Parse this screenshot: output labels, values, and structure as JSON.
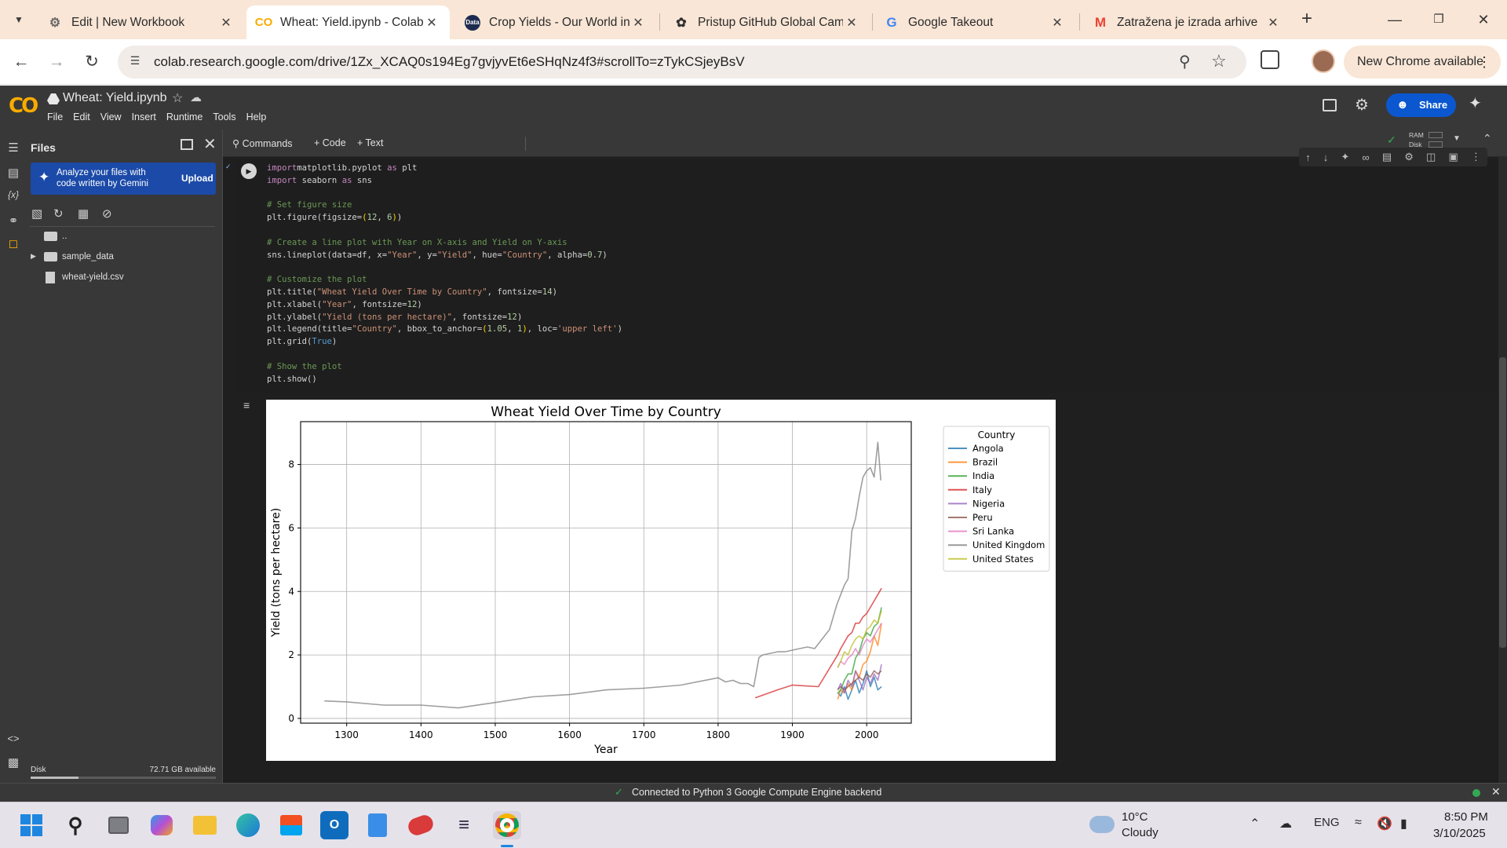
{
  "browser": {
    "tabs": [
      {
        "label": "Edit | New Workbook",
        "icon": "gear-icon",
        "active": false
      },
      {
        "label": "Wheat: Yield.ipynb - Colab",
        "icon": "colab-icon",
        "active": true
      },
      {
        "label": "Crop Yields - Our World in",
        "icon": "data-icon",
        "active": false
      },
      {
        "label": "Pristup GitHub Global Cam",
        "icon": "openai-icon",
        "active": false
      },
      {
        "label": "Google Takeout",
        "icon": "google-icon",
        "active": false
      },
      {
        "label": "Zatražena je izrada arhive",
        "icon": "gmail-icon",
        "active": false
      }
    ],
    "url": "colab.research.google.com/drive/1Zx_XCAQ0s194Eg7gvjyvEt6eSHqNz4f3#scrollTo=zTykCSjeyBsV",
    "new_chrome_label": "New Chrome available"
  },
  "colab": {
    "title": "Wheat: Yield.ipynb",
    "menu": [
      "File",
      "Edit",
      "View",
      "Insert",
      "Runtime",
      "Tools",
      "Help"
    ],
    "share_label": "Share",
    "toolbar": {
      "commands": "Commands",
      "code": "+ Code",
      "text": "+ Text"
    },
    "ram_label": "RAM",
    "disk_label": "Disk"
  },
  "files_panel": {
    "title": "Files",
    "banner_text": "Analyze your files with code written by Gemini",
    "upload_label": "Upload",
    "tree": [
      {
        "name": "..",
        "type": "folder",
        "expandable": false
      },
      {
        "name": "sample_data",
        "type": "folder",
        "expandable": true
      },
      {
        "name": "wheat-yield.csv",
        "type": "file",
        "expandable": false
      }
    ],
    "disk_label": "Disk",
    "disk_available": "72.71 GB available",
    "disk_used_fraction": 0.26
  },
  "code_lines": [
    [
      [
        "kw",
        "import"
      ],
      [
        "",
        "matplotlib.pyplot "
      ],
      [
        "kw",
        "as"
      ],
      [
        "",
        " plt"
      ]
    ],
    [
      [
        "kw",
        "import"
      ],
      [
        "",
        " seaborn "
      ],
      [
        "kw",
        "as"
      ],
      [
        "",
        " sns"
      ]
    ],
    [],
    [
      [
        "cm",
        "# Set figure size"
      ]
    ],
    [
      [
        "",
        "plt.figure(figsize="
      ],
      [
        "br",
        "("
      ],
      [
        "nm",
        "12"
      ],
      [
        "",
        ", "
      ],
      [
        "nm",
        "6"
      ],
      [
        "br",
        ")"
      ],
      [
        "",
        ")"
      ]
    ],
    [],
    [
      [
        "cm",
        "# Create a line plot with Year on X-axis and Yield on Y-axis"
      ]
    ],
    [
      [
        "",
        "sns.lineplot(data=df, x="
      ],
      [
        "st",
        "\"Year\""
      ],
      [
        "",
        ", y="
      ],
      [
        "st",
        "\"Yield\""
      ],
      [
        "",
        ", hue="
      ],
      [
        "st",
        "\"Country\""
      ],
      [
        "",
        ", alpha="
      ],
      [
        "nm",
        "0.7"
      ],
      [
        "",
        ")"
      ]
    ],
    [],
    [
      [
        "cm",
        "# Customize the plot"
      ]
    ],
    [
      [
        "",
        "plt.title("
      ],
      [
        "st",
        "\"Wheat Yield Over Time by Country\""
      ],
      [
        "",
        ", fontsize="
      ],
      [
        "nm",
        "14"
      ],
      [
        "",
        ")"
      ]
    ],
    [
      [
        "",
        "plt.xlabel("
      ],
      [
        "st",
        "\"Year\""
      ],
      [
        "",
        ", fontsize="
      ],
      [
        "nm",
        "12"
      ],
      [
        "",
        ")"
      ]
    ],
    [
      [
        "",
        "plt.ylabel("
      ],
      [
        "st",
        "\"Yield (tons per hectare)\""
      ],
      [
        "",
        ", fontsize="
      ],
      [
        "nm",
        "12"
      ],
      [
        "",
        ")"
      ]
    ],
    [
      [
        "",
        "plt.legend(title="
      ],
      [
        "st",
        "\"Country\""
      ],
      [
        "",
        ", bbox_to_anchor="
      ],
      [
        "br",
        "("
      ],
      [
        "nm",
        "1.05"
      ],
      [
        "",
        ", "
      ],
      [
        "nm",
        "1"
      ],
      [
        "br",
        ")"
      ],
      [
        "",
        ", loc="
      ],
      [
        "st",
        "'upper left'"
      ],
      [
        "",
        ")"
      ]
    ],
    [
      [
        "",
        "plt.grid("
      ],
      [
        "bi",
        "True"
      ],
      [
        "",
        ")"
      ]
    ],
    [],
    [
      [
        "cm",
        "# Show the plot"
      ]
    ],
    [
      [
        "",
        "plt.show()"
      ]
    ]
  ],
  "chart_data": {
    "type": "line",
    "title": "Wheat Yield Over Time by Country",
    "xlabel": "Year",
    "ylabel": "Yield (tons per hectare)",
    "xlim": [
      1238,
      2060
    ],
    "ylim": [
      -0.15,
      9.35
    ],
    "xticks": [
      1300,
      1400,
      1500,
      1600,
      1700,
      1800,
      1900,
      2000
    ],
    "yticks": [
      0,
      2,
      4,
      6,
      8
    ],
    "grid": true,
    "legend": {
      "title": "Country",
      "placement": "outside upper-right"
    },
    "series": [
      {
        "name": "Angola",
        "color": "#1f77b4",
        "points": [
          [
            1961,
            0.8
          ],
          [
            1965,
            0.7
          ],
          [
            1970,
            1.0
          ],
          [
            1975,
            0.6
          ],
          [
            1980,
            0.9
          ],
          [
            1985,
            1.2
          ],
          [
            1990,
            0.8
          ],
          [
            1995,
            1.1
          ],
          [
            2000,
            1.5
          ],
          [
            2005,
            1.0
          ],
          [
            2010,
            1.3
          ],
          [
            2015,
            0.9
          ],
          [
            2020,
            1.0
          ]
        ]
      },
      {
        "name": "Brazil",
        "color": "#ff7f0e",
        "points": [
          [
            1961,
            0.6
          ],
          [
            1965,
            0.9
          ],
          [
            1970,
            0.8
          ],
          [
            1975,
            1.1
          ],
          [
            1980,
            0.9
          ],
          [
            1985,
            1.5
          ],
          [
            1990,
            1.3
          ],
          [
            1995,
            1.7
          ],
          [
            2000,
            1.8
          ],
          [
            2005,
            2.1
          ],
          [
            2010,
            2.6
          ],
          [
            2015,
            2.3
          ],
          [
            2020,
            3.0
          ]
        ]
      },
      {
        "name": "India",
        "color": "#2ca02c",
        "points": [
          [
            1961,
            0.8
          ],
          [
            1965,
            0.9
          ],
          [
            1970,
            1.2
          ],
          [
            1975,
            1.4
          ],
          [
            1980,
            1.4
          ],
          [
            1985,
            1.9
          ],
          [
            1990,
            2.1
          ],
          [
            1995,
            2.5
          ],
          [
            2000,
            2.7
          ],
          [
            2005,
            2.6
          ],
          [
            2010,
            2.9
          ],
          [
            2015,
            3.0
          ],
          [
            2020,
            3.5
          ]
        ]
      },
      {
        "name": "Italy",
        "color": "#d62728",
        "points": [
          [
            1850,
            0.65
          ],
          [
            1880,
            0.9
          ],
          [
            1900,
            1.05
          ],
          [
            1935,
            1.0
          ],
          [
            1961,
            2.0
          ],
          [
            1965,
            2.2
          ],
          [
            1970,
            2.4
          ],
          [
            1975,
            2.6
          ],
          [
            1980,
            2.7
          ],
          [
            1985,
            3.0
          ],
          [
            1990,
            3.0
          ],
          [
            1995,
            3.2
          ],
          [
            2000,
            3.3
          ],
          [
            2005,
            3.5
          ],
          [
            2010,
            3.7
          ],
          [
            2015,
            3.9
          ],
          [
            2020,
            4.1
          ]
        ]
      },
      {
        "name": "Nigeria",
        "color": "#9467bd",
        "points": [
          [
            1961,
            0.9
          ],
          [
            1965,
            1.1
          ],
          [
            1970,
            0.8
          ],
          [
            1975,
            1.2
          ],
          [
            1980,
            1.0
          ],
          [
            1985,
            1.5
          ],
          [
            1990,
            1.2
          ],
          [
            1995,
            0.9
          ],
          [
            2000,
            1.3
          ],
          [
            2005,
            1.1
          ],
          [
            2010,
            1.4
          ],
          [
            2015,
            1.2
          ],
          [
            2020,
            1.7
          ]
        ]
      },
      {
        "name": "Peru",
        "color": "#8c564b",
        "points": [
          [
            1961,
            0.9
          ],
          [
            1965,
            1.0
          ],
          [
            1970,
            0.9
          ],
          [
            1975,
            1.0
          ],
          [
            1980,
            1.1
          ],
          [
            1985,
            1.2
          ],
          [
            1990,
            1.3
          ],
          [
            1995,
            1.2
          ],
          [
            2000,
            1.4
          ],
          [
            2005,
            1.3
          ],
          [
            2010,
            1.5
          ],
          [
            2015,
            1.4
          ],
          [
            2020,
            1.5
          ]
        ]
      },
      {
        "name": "Sri Lanka",
        "color": "#e377c2",
        "points": [
          [
            1961,
            1.6
          ],
          [
            1965,
            1.8
          ],
          [
            1970,
            1.7
          ],
          [
            1975,
            1.9
          ],
          [
            1980,
            2.0
          ],
          [
            1985,
            2.2
          ],
          [
            1990,
            2.0
          ],
          [
            1995,
            2.3
          ],
          [
            2000,
            2.5
          ],
          [
            2005,
            2.4
          ],
          [
            2010,
            2.6
          ],
          [
            2015,
            2.8
          ],
          [
            2020,
            3.0
          ]
        ]
      },
      {
        "name": "United Kingdom",
        "color": "#7f7f7f",
        "points": [
          [
            1270,
            0.55
          ],
          [
            1300,
            0.52
          ],
          [
            1350,
            0.42
          ],
          [
            1400,
            0.42
          ],
          [
            1450,
            0.33
          ],
          [
            1500,
            0.5
          ],
          [
            1550,
            0.68
          ],
          [
            1600,
            0.75
          ],
          [
            1650,
            0.9
          ],
          [
            1700,
            0.95
          ],
          [
            1750,
            1.05
          ],
          [
            1800,
            1.28
          ],
          [
            1810,
            1.15
          ],
          [
            1820,
            1.2
          ],
          [
            1830,
            1.1
          ],
          [
            1840,
            1.1
          ],
          [
            1848,
            1.0
          ],
          [
            1855,
            1.92
          ],
          [
            1860,
            2.0
          ],
          [
            1870,
            2.05
          ],
          [
            1880,
            2.1
          ],
          [
            1890,
            2.1
          ],
          [
            1900,
            2.15
          ],
          [
            1910,
            2.2
          ],
          [
            1920,
            2.25
          ],
          [
            1930,
            2.2
          ],
          [
            1940,
            2.5
          ],
          [
            1950,
            2.8
          ],
          [
            1955,
            3.2
          ],
          [
            1960,
            3.6
          ],
          [
            1965,
            3.9
          ],
          [
            1970,
            4.2
          ],
          [
            1975,
            4.4
          ],
          [
            1980,
            5.9
          ],
          [
            1985,
            6.3
          ],
          [
            1990,
            7.0
          ],
          [
            1995,
            7.6
          ],
          [
            2000,
            7.8
          ],
          [
            2005,
            7.9
          ],
          [
            2010,
            7.6
          ],
          [
            2015,
            8.7
          ],
          [
            2019,
            7.5
          ]
        ]
      },
      {
        "name": "United States",
        "color": "#bcbd22",
        "points": [
          [
            1961,
            1.6
          ],
          [
            1965,
            1.8
          ],
          [
            1970,
            2.1
          ],
          [
            1975,
            2.0
          ],
          [
            1980,
            2.3
          ],
          [
            1985,
            2.5
          ],
          [
            1990,
            2.6
          ],
          [
            1995,
            2.5
          ],
          [
            2000,
            2.8
          ],
          [
            2005,
            2.9
          ],
          [
            2010,
            3.1
          ],
          [
            2015,
            3.0
          ],
          [
            2020,
            3.4
          ]
        ]
      }
    ]
  },
  "status": {
    "text": "Connected to Python 3 Google Compute Engine backend"
  },
  "taskbar": {
    "apps": [
      "start-icon",
      "search-icon",
      "task-view-icon",
      "copilot-icon",
      "file-explorer-icon",
      "edge-icon",
      "store-icon",
      "outlook-icon",
      "notepad-icon",
      "app-icon",
      "app-icon",
      "chrome-icon"
    ],
    "weather_temp": "10°C",
    "weather_cond": "Cloudy",
    "lang": "ENG",
    "time": "8:50 PM",
    "date": "3/10/2025"
  }
}
